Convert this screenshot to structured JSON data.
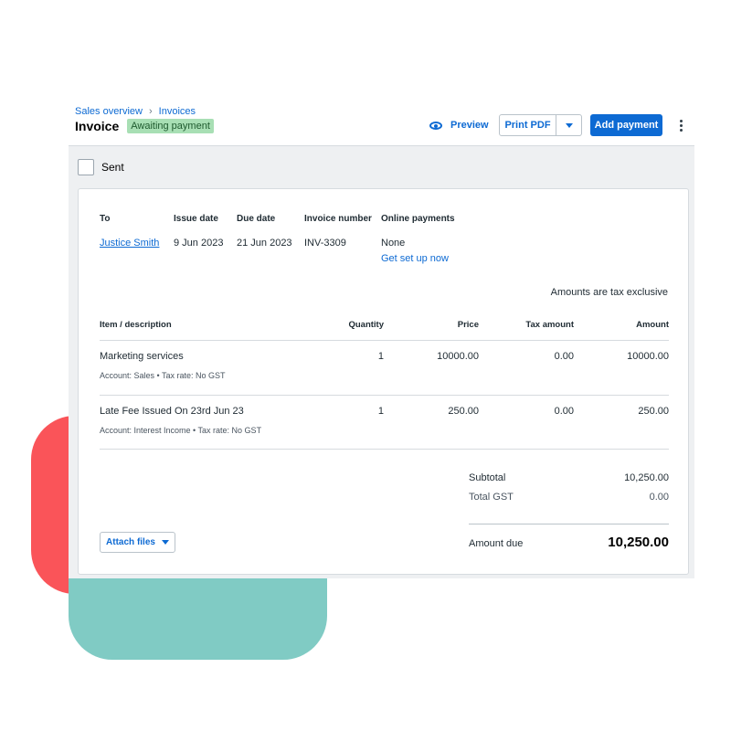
{
  "colors": {
    "accent": "#0d6ad3",
    "badge_bg": "#a8dfb4",
    "deco_red": "#fa5459",
    "deco_teal": "#80cbc4",
    "deco_dark": "#33404a"
  },
  "breadcrumb": {
    "items": [
      "Sales overview",
      "Invoices"
    ]
  },
  "header": {
    "title": "Invoice",
    "status": "Awaiting payment",
    "preview_label": "Preview",
    "print_label": "Print PDF",
    "add_payment_label": "Add payment"
  },
  "sent": {
    "label": "Sent",
    "checked": false
  },
  "invoice": {
    "to_label": "To",
    "to_value": "Justice Smith",
    "issue_label": "Issue date",
    "issue_value": "9 Jun 2023",
    "due_label": "Due date",
    "due_value": "21 Jun 2023",
    "number_label": "Invoice number",
    "number_value": "INV-3309",
    "online_label": "Online payments",
    "online_value": "None",
    "online_link": "Get set up now",
    "tax_note": "Amounts are tax exclusive"
  },
  "table": {
    "columns": [
      "Item / description",
      "Quantity",
      "Price",
      "Tax amount",
      "Amount"
    ],
    "rows": [
      {
        "item": "Marketing services",
        "detail": "Account: Sales • Tax rate: No GST",
        "quantity": "1",
        "price": "10000.00",
        "tax": "0.00",
        "amount": "10000.00"
      },
      {
        "item": "Late Fee Issued On 23rd Jun 23",
        "detail": "Account: Interest Income • Tax rate: No GST",
        "quantity": "1",
        "price": "250.00",
        "tax": "0.00",
        "amount": "250.00"
      }
    ]
  },
  "totals": {
    "subtotal_label": "Subtotal",
    "subtotal_value": "10,250.00",
    "gst_label": "Total GST",
    "gst_value": "0.00",
    "due_label": "Amount due",
    "due_value": "10,250.00"
  },
  "attach": {
    "label": "Attach files"
  }
}
